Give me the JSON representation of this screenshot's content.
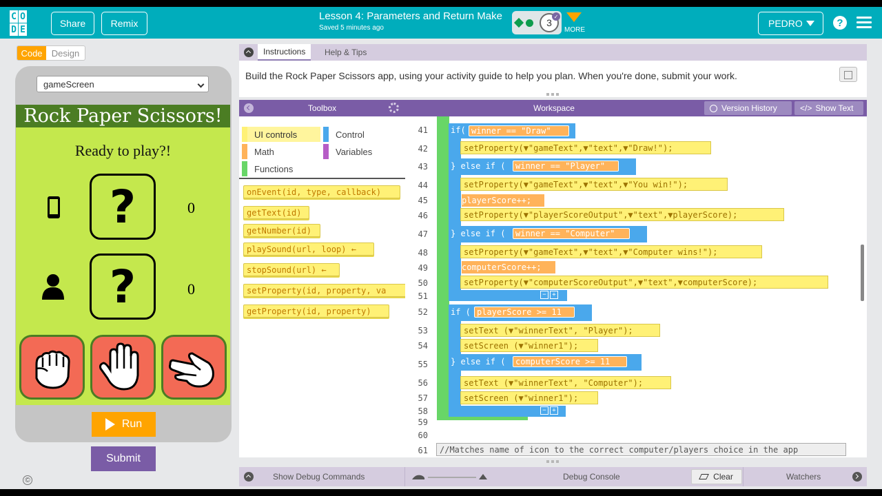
{
  "header": {
    "logo_letters": [
      "C",
      "O",
      "D",
      "E"
    ],
    "share_label": "Share",
    "remix_label": "Remix",
    "lesson_title": "Lesson 4: Parameters and Return Make",
    "saved_status": "Saved 5 minutes ago",
    "level_number": "3",
    "more_label": "MORE",
    "user_name": "PEDRO",
    "help_glyph": "?",
    "accent_color": "#00adbc"
  },
  "mode_toggle": {
    "code_label": "Code",
    "design_label": "Design"
  },
  "app_preview": {
    "screen_selected": "gameScreen",
    "title": "Rock Paper Scissors!",
    "subtitle": "Ready to play?!",
    "computer_choice": "?",
    "player_choice": "?",
    "computer_score": "0",
    "player_score": "0",
    "icons": [
      "phone-icon",
      "person-icon",
      "rock-hand-icon",
      "paper-hand-icon",
      "scissors-hand-icon"
    ]
  },
  "run_label": "Run",
  "submit_label": "Submit",
  "copyright_glyph": "©",
  "instructions": {
    "tab_instructions": "Instructions",
    "tab_help": "Help & Tips",
    "text": "Build the Rock Paper Scissors app, using your activity guide to help you plan. When you're done, submit your work."
  },
  "toolbox": {
    "title": "Toolbox",
    "categories": [
      {
        "label": "UI controls",
        "color": "#fff176"
      },
      {
        "label": "Control",
        "color": "#4aa8ec"
      },
      {
        "label": "Math",
        "color": "#ffb35a"
      },
      {
        "label": "Variables",
        "color": "#b65dc6"
      },
      {
        "label": "Functions",
        "color": "#68d667"
      }
    ],
    "blocks": [
      "onEvent(id, type, callback)",
      "getText(id)",
      "getNumber(id)",
      "playSound(url, loop) ←",
      "stopSound(url) ←",
      "setProperty(id, property, va",
      "getProperty(id, property)"
    ]
  },
  "workspace": {
    "title": "Workspace",
    "version_history_label": "Version History",
    "show_text_label": "Show Text",
    "line_numbers": [
      "41",
      "42",
      "43",
      "44",
      "45",
      "46",
      "47",
      "48",
      "49",
      "50",
      "51",
      "52",
      "53",
      "54",
      "55",
      "56",
      "57",
      "58",
      "59",
      "60",
      "61"
    ],
    "code": {
      "l41_kw": "if(",
      "l41_cond": "winner == \"Draw\"",
      "l42": "setProperty(▼\"gameText\",▼\"text\",▼\"Draw!\");",
      "l43_kw": "} else if (",
      "l43_cond": "winner == \"Player\"",
      "l44": "setProperty(▼\"gameText\",▼\"text\",▼\"You win!\");",
      "l45": "playerScore++;",
      "l46": "setProperty(▼\"playerScoreOutput\",▼\"text\",▼playerScore);",
      "l47_kw": "} else if (",
      "l47_cond": "winner == \"Computer\"",
      "l48": "setProperty(▼\"gameText\",▼\"text\",▼\"Computer wins!\");",
      "l49": "computerScore++;",
      "l50": "setProperty(▼\"computerScoreOutput\",▼\"text\",▼computerScore);",
      "l52_kw": "if (",
      "l52_cond": "playerScore >= 11",
      "l53": "setText (▼\"winnerText\", \"Player\");",
      "l54": "setScreen (▼\"winner1\");",
      "l55_kw": "} else if (",
      "l55_cond": "computerScore >= 11",
      "l56": "setText (▼\"winnerText\", \"Computer\");",
      "l57": "setScreen (▼\"winner1\");",
      "l61": "//Matches name of icon to the correct computer/players choice in the app",
      "brace": "{",
      "close_brace": "}",
      "minus": "−",
      "plus": "+"
    }
  },
  "footer": {
    "show_debug_label": "Show Debug Commands",
    "debug_console_label": "Debug Console",
    "clear_label": "Clear",
    "watchers_label": "Watchers"
  }
}
